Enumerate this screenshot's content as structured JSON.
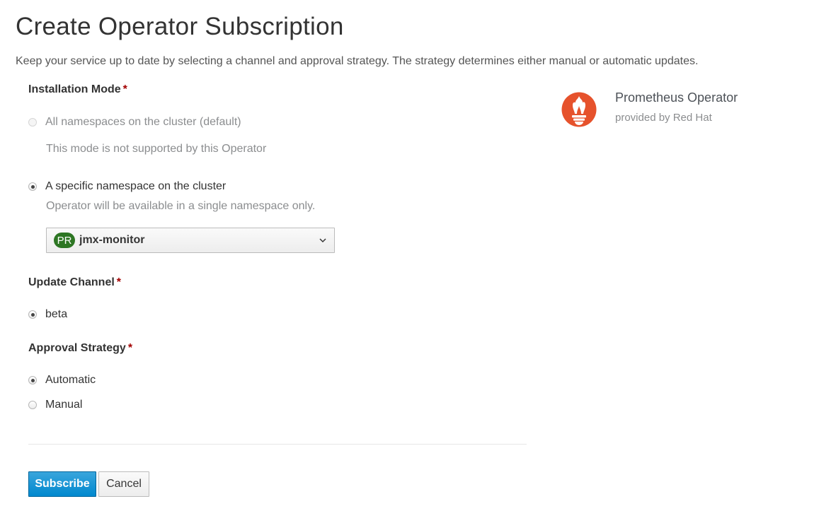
{
  "page": {
    "title": "Create Operator Subscription",
    "description": "Keep your service up to date by selecting a channel and approval strategy. The strategy determines either manual or automatic updates."
  },
  "installation_mode": {
    "label": "Installation Mode",
    "required_marker": "*",
    "options": [
      {
        "label": "All namespaces on the cluster (default)",
        "help": "This mode is not supported by this Operator",
        "selected": false,
        "disabled": true
      },
      {
        "label": "A specific namespace on the cluster",
        "help": "Operator will be available in a single namespace only.",
        "selected": true,
        "disabled": false
      }
    ],
    "namespace_select": {
      "badge": "PR",
      "value": "jmx-monitor",
      "badge_color": "#2d7623"
    }
  },
  "update_channel": {
    "label": "Update Channel",
    "required_marker": "*",
    "options": [
      {
        "label": "beta",
        "selected": true
      }
    ]
  },
  "approval_strategy": {
    "label": "Approval Strategy",
    "required_marker": "*",
    "options": [
      {
        "label": "Automatic",
        "selected": true
      },
      {
        "label": "Manual",
        "selected": false
      }
    ]
  },
  "actions": {
    "subscribe_label": "Subscribe",
    "cancel_label": "Cancel"
  },
  "operator": {
    "name": "Prometheus Operator",
    "provider": "provided by Red Hat",
    "logo_icon": "prometheus-logo-icon",
    "logo_color": "#e6522c"
  },
  "colors": {
    "primary": "#0088ce",
    "required": "#a30000"
  }
}
